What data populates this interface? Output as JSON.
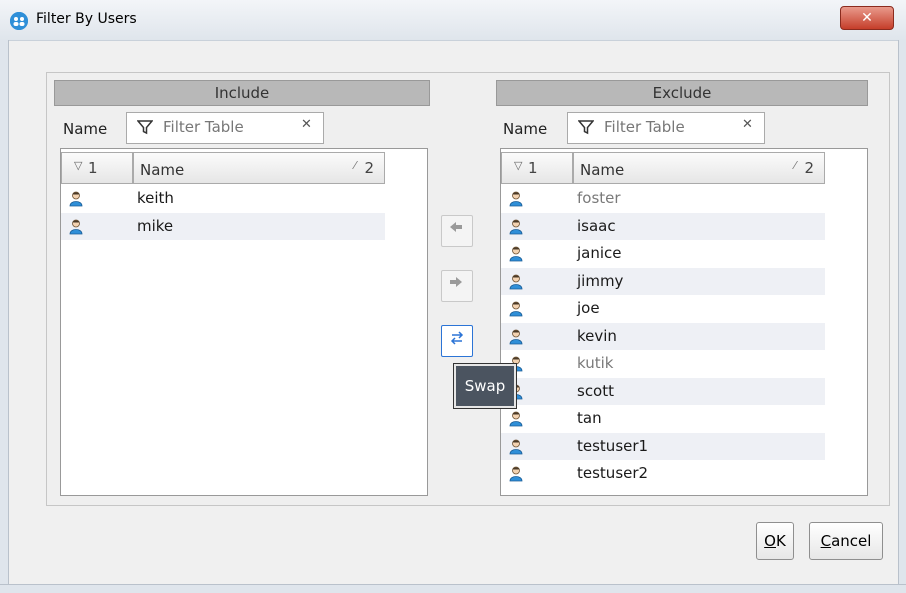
{
  "window": {
    "title": "Filter By Users",
    "close_glyph": "✕",
    "app_icon_text": "👥"
  },
  "include": {
    "header": "Include",
    "filter_label": "Name",
    "filter_placeholder": "Filter Table",
    "clear_glyph": "✕",
    "col_sort_num": "1",
    "col_name": "Name",
    "col_name_num": "2",
    "users": [
      "keith",
      "mike"
    ]
  },
  "exclude": {
    "header": "Exclude",
    "filter_label": "Name",
    "filter_placeholder": "Filter Table",
    "clear_glyph": "✕",
    "col_sort_num": "1",
    "col_name": "Name",
    "col_name_num": "2",
    "users": [
      "foster",
      "isaac",
      "janice",
      "jimmy",
      "joe",
      "kevin",
      "kutik",
      "scott",
      "tan",
      "testuser1",
      "testuser2"
    ],
    "dimmed_users": [
      "foster",
      "kutik"
    ]
  },
  "transfer": {
    "move_left_icon": "arrow-left-icon",
    "move_right_icon": "arrow-right-icon",
    "swap_icon": "swap-icon",
    "tooltip": "Swap"
  },
  "footer": {
    "ok_mnemonic": "O",
    "ok_rest": "K",
    "cancel_mnemonic": "C",
    "cancel_rest": "ancel"
  },
  "colors": {
    "accent": "#2b74d6",
    "header_bg": "#b8b8b8",
    "row_alt": "#eef0f5",
    "dimmed_text": "#7a7a7a"
  }
}
